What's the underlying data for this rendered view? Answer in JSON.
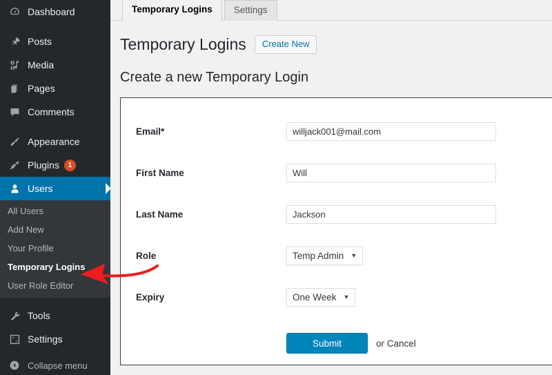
{
  "sidebar": {
    "items": [
      {
        "label": "Dashboard",
        "icon": "dashboard-icon",
        "name": "sidebar-item-dashboard"
      },
      {
        "label": "Posts",
        "icon": "pin-icon",
        "name": "sidebar-item-posts"
      },
      {
        "label": "Media",
        "icon": "media-icon",
        "name": "sidebar-item-media"
      },
      {
        "label": "Pages",
        "icon": "pages-icon",
        "name": "sidebar-item-pages"
      },
      {
        "label": "Comments",
        "icon": "comment-icon",
        "name": "sidebar-item-comments"
      },
      {
        "label": "Appearance",
        "icon": "brush-icon",
        "name": "sidebar-item-appearance"
      },
      {
        "label": "Plugins",
        "icon": "plug-icon",
        "name": "sidebar-item-plugins",
        "badge": "1"
      },
      {
        "label": "Users",
        "icon": "user-icon",
        "name": "sidebar-item-users",
        "current": true
      }
    ],
    "submenu": [
      {
        "label": "All Users",
        "name": "submenu-item-all-users"
      },
      {
        "label": "Add New",
        "name": "submenu-item-add-new"
      },
      {
        "label": "Your Profile",
        "name": "submenu-item-your-profile"
      },
      {
        "label": "Temporary Logins",
        "name": "submenu-item-temporary-logins",
        "current": true
      },
      {
        "label": "User Role Editor",
        "name": "submenu-item-user-role-editor"
      }
    ],
    "bottom_items": [
      {
        "label": "Tools",
        "icon": "wrench-icon",
        "name": "sidebar-item-tools"
      },
      {
        "label": "Settings",
        "icon": "sliders-icon",
        "name": "sidebar-item-settings"
      }
    ],
    "collapse": {
      "label": "Collapse menu",
      "icon": "collapse-icon"
    },
    "badge_color": "#d54e21",
    "current_color": "#0073aa"
  },
  "tabs": [
    {
      "label": "Temporary Logins",
      "active": true
    },
    {
      "label": "Settings",
      "active": false
    }
  ],
  "page": {
    "title": "Temporary Logins",
    "create_new_label": "Create New",
    "section_title": "Create a new Temporary Login"
  },
  "form": {
    "email": {
      "label": "Email*",
      "value": "willjack001@mail.com",
      "placeholder": ""
    },
    "first_name": {
      "label": "First Name",
      "value": "Will",
      "placeholder": ""
    },
    "last_name": {
      "label": "Last Name",
      "value": "Jackson",
      "placeholder": ""
    },
    "role": {
      "label": "Role",
      "value": "Temp Admin",
      "caret": "▼"
    },
    "expiry": {
      "label": "Expiry",
      "value": "One Week",
      "caret": "▼"
    },
    "submit_label": "Submit",
    "cancel_text": "or Cancel"
  },
  "annotation": {
    "color": "#ee1c1c",
    "description": "red arrow pointing at Temporary Logins menu item"
  }
}
